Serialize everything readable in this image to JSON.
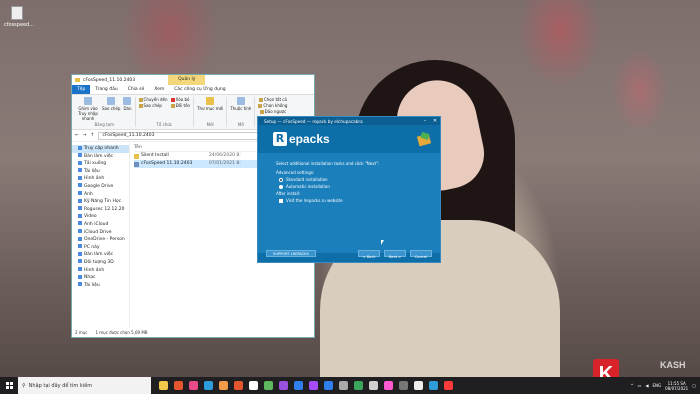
{
  "desktop": {
    "icon_label": "cfosspeed..."
  },
  "explorer": {
    "title": "cFosSpeed_11.10.2403",
    "context_tab": "Quản lý",
    "tabs": [
      "Tệp",
      "Trang đầu",
      "Chia sẻ",
      "Xem",
      "Các công cụ Ứng dụng"
    ],
    "ribbon": {
      "pin": "Ghim vào Truy nhập nhanh",
      "copy": "Sao chép",
      "paste": "Dán",
      "clipboard_label": "Bảng tạm",
      "move_to": "Chuyển đến",
      "copy_to": "Sao chép",
      "delete": "Xóa bỏ",
      "rename": "Đổi tên",
      "organize_label": "Tổ chức",
      "new_folder": "Thư mục mới",
      "new_label": "Mới",
      "properties": "Thuộc tính",
      "open_label": "Mở",
      "select_all": "Chọn tất cả",
      "select_none": "Chọn không",
      "invert": "Đảo ngược"
    },
    "address": "cFosSpeed_11.10.2403",
    "nav_items": [
      "Truy cập nhanh",
      "Bàn làm việc",
      "Tải xuống",
      "Tài liệu",
      "Hình ảnh",
      "Google Drive",
      "Ảnh",
      "Kỹ Năng Tin Học",
      "Rogusec 12.12.20",
      "Video",
      "Ảnh iCloud",
      "iCloud Drive",
      "OneDrive - Person",
      "PC này",
      "Bàn làm việc",
      "Đối tượng 3D",
      "Hình ảnh",
      "Nhạc",
      "Tài liệu"
    ],
    "col_name": "Tên",
    "files": [
      {
        "name": "Silent Install",
        "date": "24/06/2020 8:"
      },
      {
        "name": "cFosSpeed 11.10.2403",
        "date": "07/01/2021 8:"
      }
    ],
    "status_count": "2 mục",
    "status_selected": "1 mục được chọn 5,69 MB"
  },
  "setup": {
    "title": "Setup — cFosSpeed — repack by elchupacabra",
    "logo_text": "epacks",
    "logo_letter": "R",
    "prompt": "Select additional installation tasks and click \"Next\":",
    "advanced": "Advanced settings:",
    "opt_standard": "Standard installation",
    "opt_auto": "Automatic installation",
    "after_install": "After install:",
    "visit": "Visit the lrepacks.ru website",
    "support_btn": "SUPPORT LREPACKS",
    "back_btn": "< Back",
    "next_btn": "Next >",
    "cancel_btn": "Cancel"
  },
  "taskbar": {
    "search_placeholder": "Nhập tại đây để tìm kiếm",
    "lang": "ENG",
    "time": "11:55 SA",
    "date": "08/07/2021"
  },
  "watermark": {
    "letter": "K",
    "text": "KASH"
  }
}
